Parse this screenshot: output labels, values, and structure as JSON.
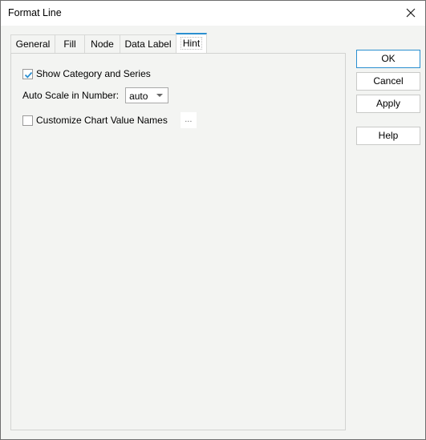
{
  "window": {
    "title": "Format Line"
  },
  "tabs": [
    {
      "label": "General",
      "active": false
    },
    {
      "label": "Fill",
      "active": false
    },
    {
      "label": "Node",
      "active": false
    },
    {
      "label": "Data Label",
      "active": false
    },
    {
      "label": "Hint",
      "active": true
    }
  ],
  "hint": {
    "show_category_and_series": {
      "label": "Show Category and Series",
      "checked": true
    },
    "auto_scale": {
      "label": "Auto Scale in Number:",
      "value": "auto"
    },
    "customize_names": {
      "label": "Customize Chart Value Names",
      "checked": false,
      "button_label": "..."
    }
  },
  "buttons": {
    "ok": "OK",
    "cancel": "Cancel",
    "apply": "Apply",
    "help": "Help"
  },
  "colors": {
    "accent": "#2a8fd0"
  }
}
